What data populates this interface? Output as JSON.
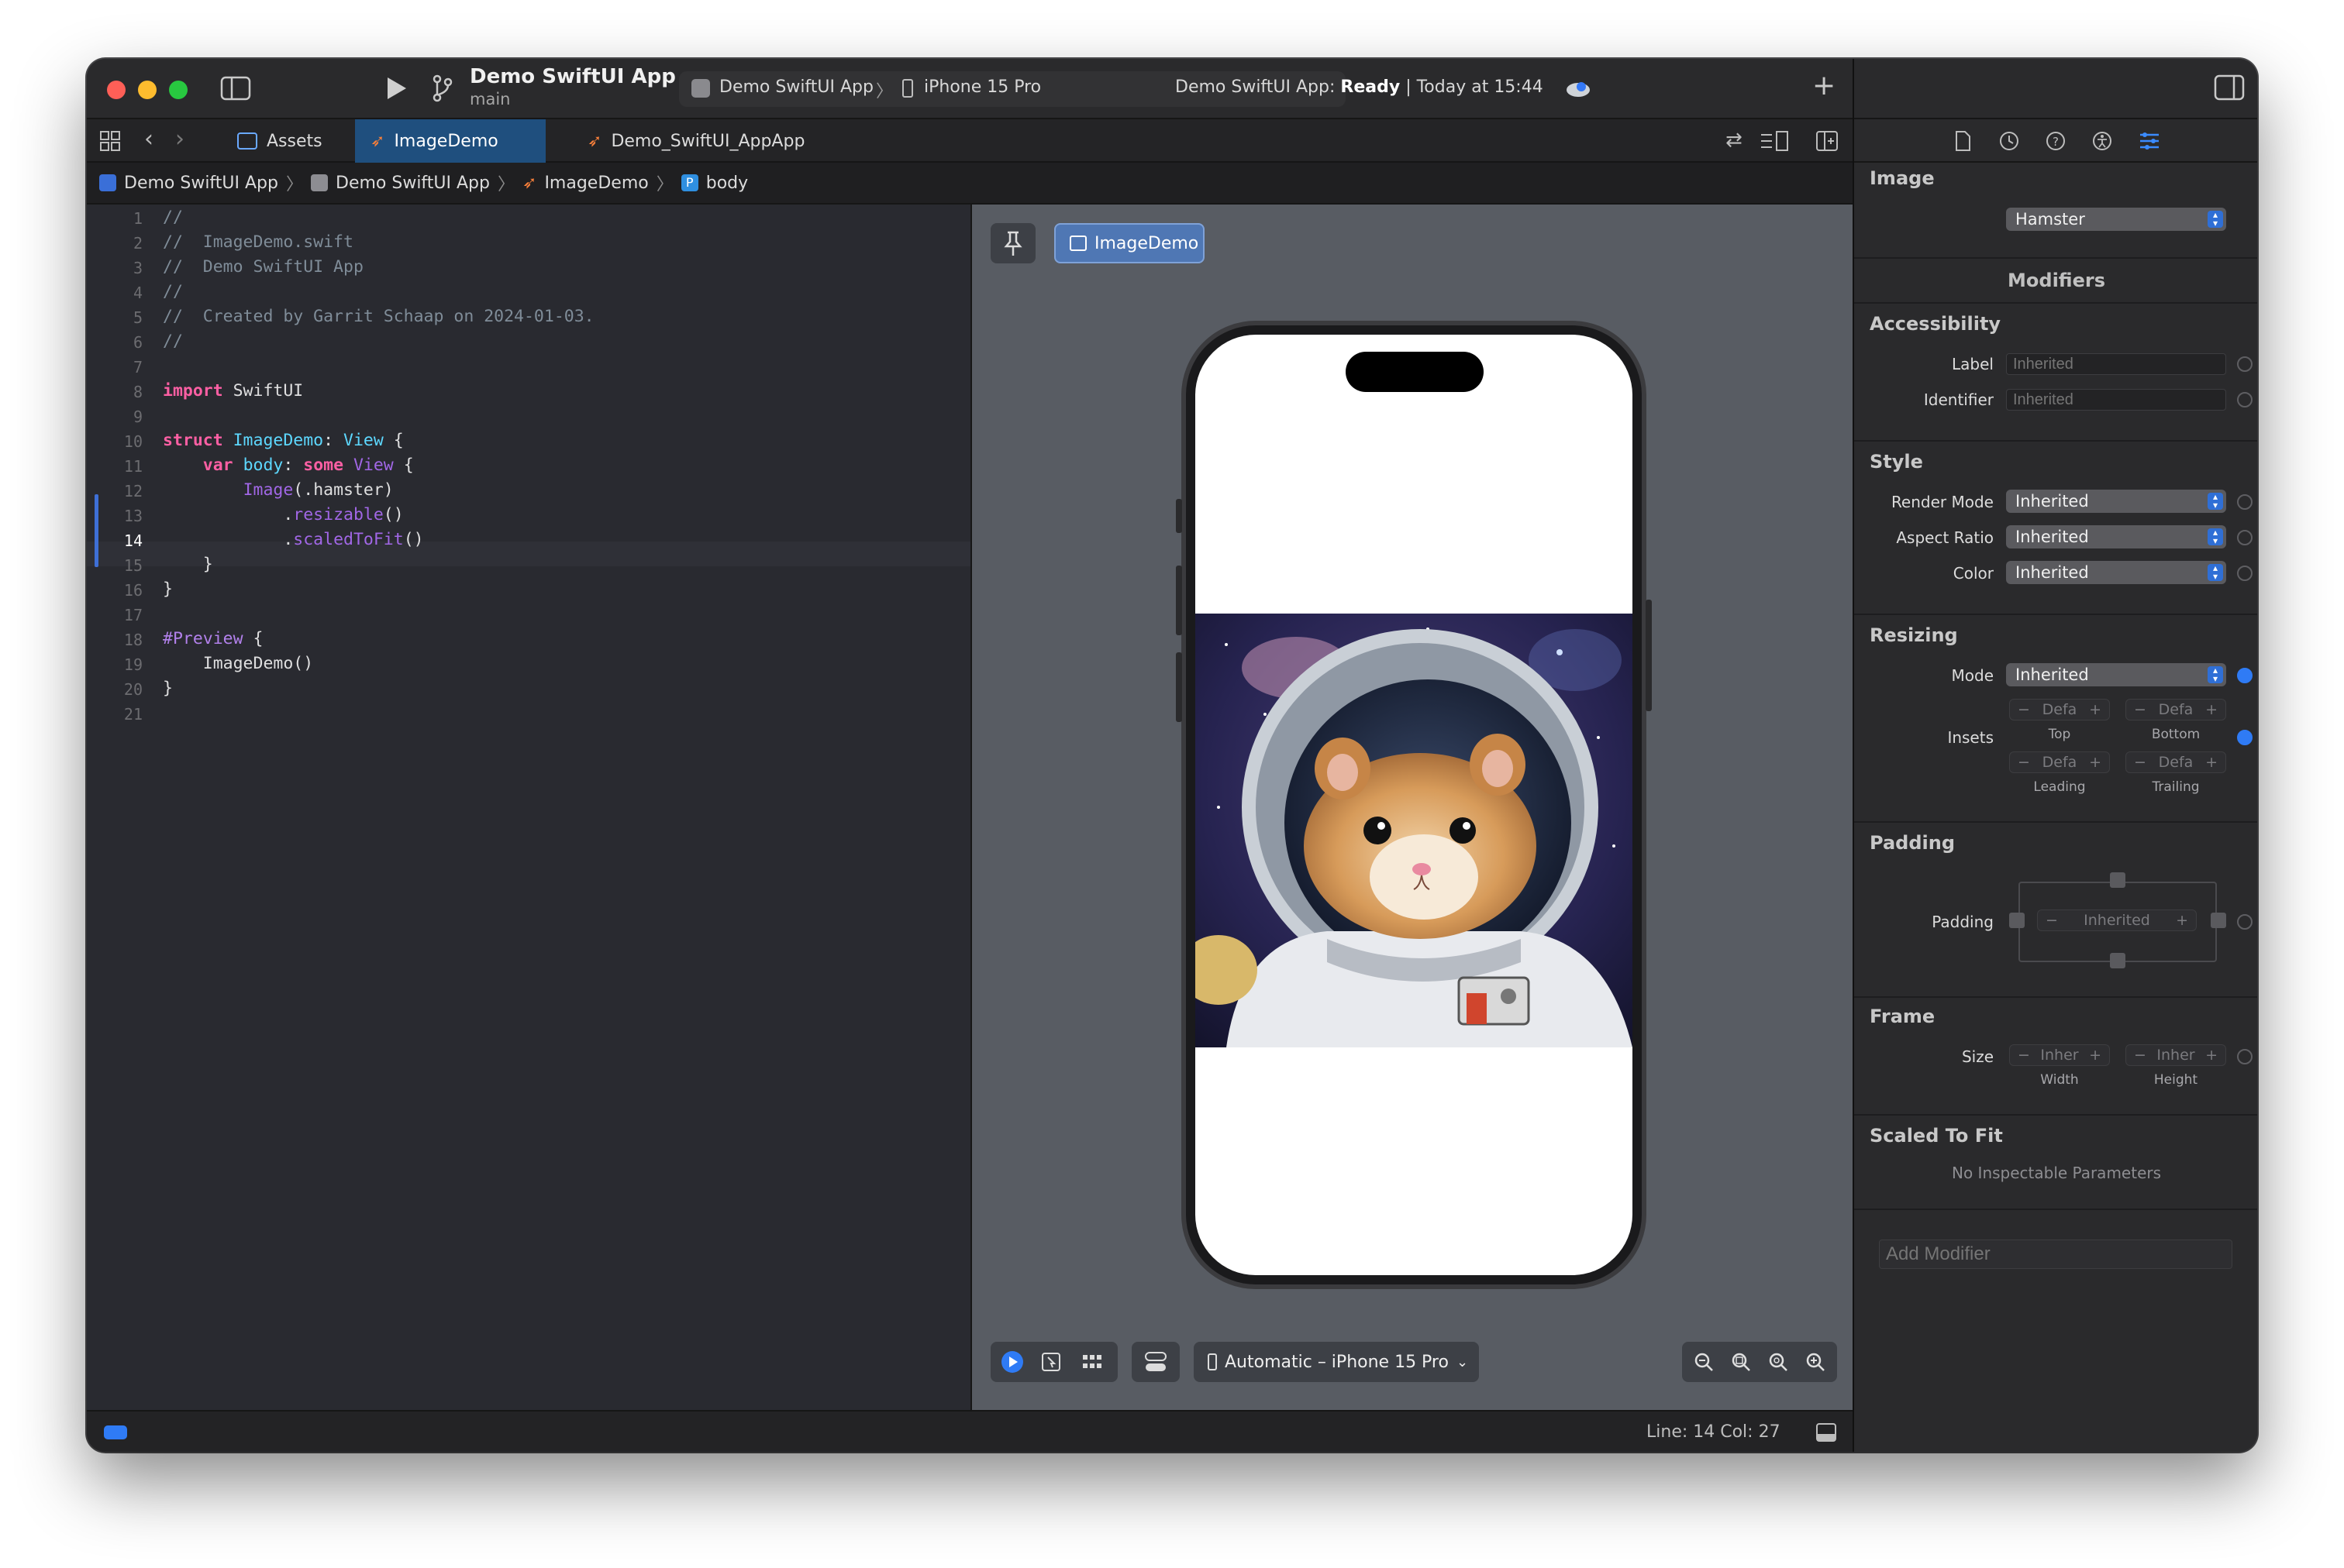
{
  "titlebar": {
    "project_name": "Demo SwiftUI App",
    "branch": "main",
    "scheme": "Demo SwiftUI App",
    "destination": "iPhone 15 Pro",
    "status_prefix": "Demo SwiftUI App:",
    "status_state": "Ready",
    "status_time": "| Today at 15:44"
  },
  "tabs": [
    {
      "label": "Assets"
    },
    {
      "label": "ImageDemo"
    },
    {
      "label": "Demo_SwiftUI_AppApp"
    }
  ],
  "breadcrumb": [
    "Demo SwiftUI App",
    "Demo SwiftUI App",
    "ImageDemo",
    "body"
  ],
  "editor": {
    "line_numbers": [
      "1",
      "2",
      "3",
      "4",
      "5",
      "6",
      "7",
      "8",
      "9",
      "10",
      "11",
      "12",
      "13",
      "14",
      "15",
      "16",
      "17",
      "18",
      "19",
      "20",
      "21"
    ],
    "current_line": 14,
    "comments": {
      "c1": "//",
      "c2": "//  ImageDemo.swift",
      "c3": "//  Demo SwiftUI App",
      "c4": "//",
      "c5": "//  Created by Garrit Schaap on 2024-01-03.",
      "c6": "//"
    },
    "tokens": {
      "import_kw": "import",
      "import_mod": " SwiftUI",
      "struct_kw": "struct",
      "struct_name": " ImageDemo",
      "colon_view": ": ",
      "view_type": "View",
      "brace_open": " {",
      "var_kw": "var",
      "body_name": " body",
      "colon": ": ",
      "some_kw": "some",
      "view_type2": " View",
      "brace_open2": " {",
      "image_type": "Image",
      "image_arg_open": "(.",
      "image_arg": "hamster",
      "image_arg_close": ")",
      "dot1": ".",
      "resizable": "resizable",
      "paren1": "()",
      "dot2": ".",
      "scaled": "scaledToFit",
      "paren2": "()",
      "brace_close_inner": "}",
      "brace_close_outer": "}",
      "preview_macro": "#Preview",
      "preview_brace": " {",
      "preview_call": "ImageDemo",
      "preview_parens": "()",
      "preview_close": "}"
    }
  },
  "canvas": {
    "preview_chip": "ImageDemo",
    "device_menu": "Automatic – iPhone 15 Pro"
  },
  "statusbar": {
    "cursor": "Line: 14  Col: 27"
  },
  "inspector": {
    "image_section": "Image",
    "image_value": "Hamster",
    "modifiers_header": "Modifiers",
    "accessibility": {
      "title": "Accessibility",
      "label_lbl": "Label",
      "label_placeholder": "Inherited",
      "identifier_lbl": "Identifier",
      "identifier_placeholder": "Inherited"
    },
    "style": {
      "title": "Style",
      "render_lbl": "Render Mode",
      "render_val": "Inherited",
      "aspect_lbl": "Aspect Ratio",
      "aspect_val": "Inherited",
      "color_lbl": "Color",
      "color_val": "Inherited"
    },
    "resizing": {
      "title": "Resizing",
      "mode_lbl": "Mode",
      "mode_val": "Inherited",
      "insets_lbl": "Insets",
      "top_val": "Defa",
      "top_sub": "Top",
      "bottom_val": "Defa",
      "bottom_sub": "Bottom",
      "leading_val": "Defa",
      "leading_sub": "Leading",
      "trailing_val": "Defa",
      "trailing_sub": "Trailing"
    },
    "padding": {
      "title": "Padding",
      "lbl": "Padding",
      "val": "Inherited"
    },
    "frame": {
      "title": "Frame",
      "size_lbl": "Size",
      "width_val": "Inher",
      "width_sub": "Width",
      "height_val": "Inher",
      "height_sub": "Height"
    },
    "scaled": {
      "title": "Scaled To Fit",
      "note": "No Inspectable Parameters"
    },
    "add_modifier_placeholder": "Add Modifier"
  }
}
